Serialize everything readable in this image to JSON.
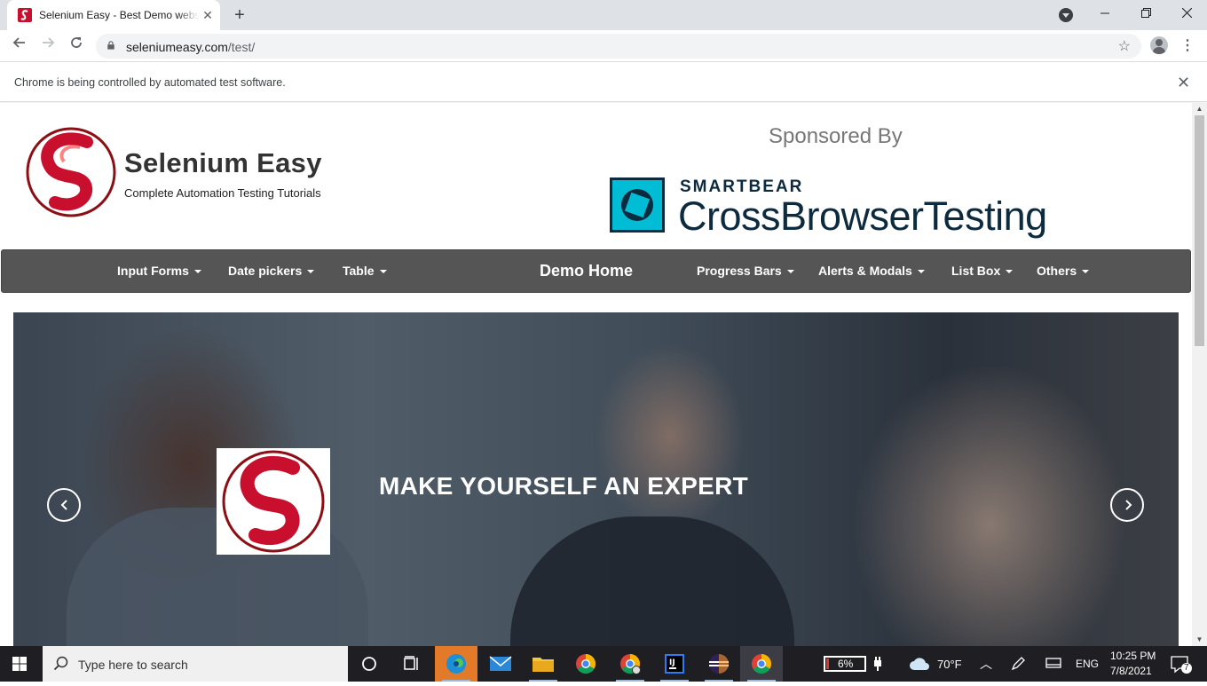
{
  "browser": {
    "tab_title": "Selenium Easy - Best Demo website",
    "url_host": "seleniumeasy.com",
    "url_path": "/test/",
    "infobar_text": "Chrome is being controlled by automated test software."
  },
  "site": {
    "brand_name": "Selenium Easy",
    "brand_tagline": "Complete Automation Testing Tutorials",
    "sponsor_label": "Sponsored By",
    "sponsor_company": "SMARTBEAR",
    "sponsor_product": "CrossBrowserTesting"
  },
  "nav": {
    "left_items": [
      "Input Forms",
      "Date pickers",
      "Table"
    ],
    "brand": "Demo Home",
    "right_items": [
      "Progress Bars",
      "Alerts & Modals",
      "List Box",
      "Others"
    ]
  },
  "hero": {
    "heading": "MAKE YOURSELF AN EXPERT"
  },
  "taskbar": {
    "search_placeholder": "Type here to search",
    "battery": "6%",
    "weather": "70°F",
    "language": "ENG",
    "time": "10:25 PM",
    "date": "7/8/2021",
    "notification_count": "7"
  },
  "colors": {
    "navbar_bg": "#555555",
    "brand_red": "#c8102e",
    "sponsor_teal": "#00bcd4",
    "sponsor_navy": "#0d2b3e"
  }
}
